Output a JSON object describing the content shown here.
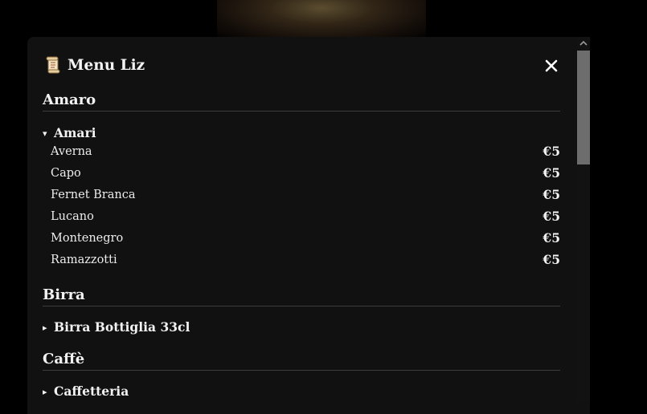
{
  "modal": {
    "title": "Menu Liz",
    "title_icon": "scroll-icon",
    "close_icon": "close-icon"
  },
  "sections": [
    {
      "title": "Amaro",
      "groups": [
        {
          "title": "Amari",
          "expanded": true,
          "marker": "▾",
          "items": [
            {
              "name": "Averna",
              "price": "€5"
            },
            {
              "name": "Capo",
              "price": "€5"
            },
            {
              "name": "Fernet Branca",
              "price": "€5"
            },
            {
              "name": "Lucano",
              "price": "€5"
            },
            {
              "name": "Montenegro",
              "price": "€5"
            },
            {
              "name": "Ramazzotti",
              "price": "€5"
            }
          ]
        }
      ]
    },
    {
      "title": "Birra",
      "groups": [
        {
          "title": "Birra Bottiglia 33cl",
          "expanded": false,
          "marker": "▸"
        }
      ]
    },
    {
      "title": "Caffè",
      "groups": [
        {
          "title": "Caffetteria",
          "expanded": false,
          "marker": "▸"
        }
      ]
    }
  ],
  "scrollbar": {
    "up_icon": "chevron-up-icon"
  },
  "colors": {
    "background": "#000000",
    "modal": "#111112",
    "text": "#f2f2f2",
    "divider": "#3d3d3e",
    "scroll_thumb": "#6d6d6d"
  }
}
